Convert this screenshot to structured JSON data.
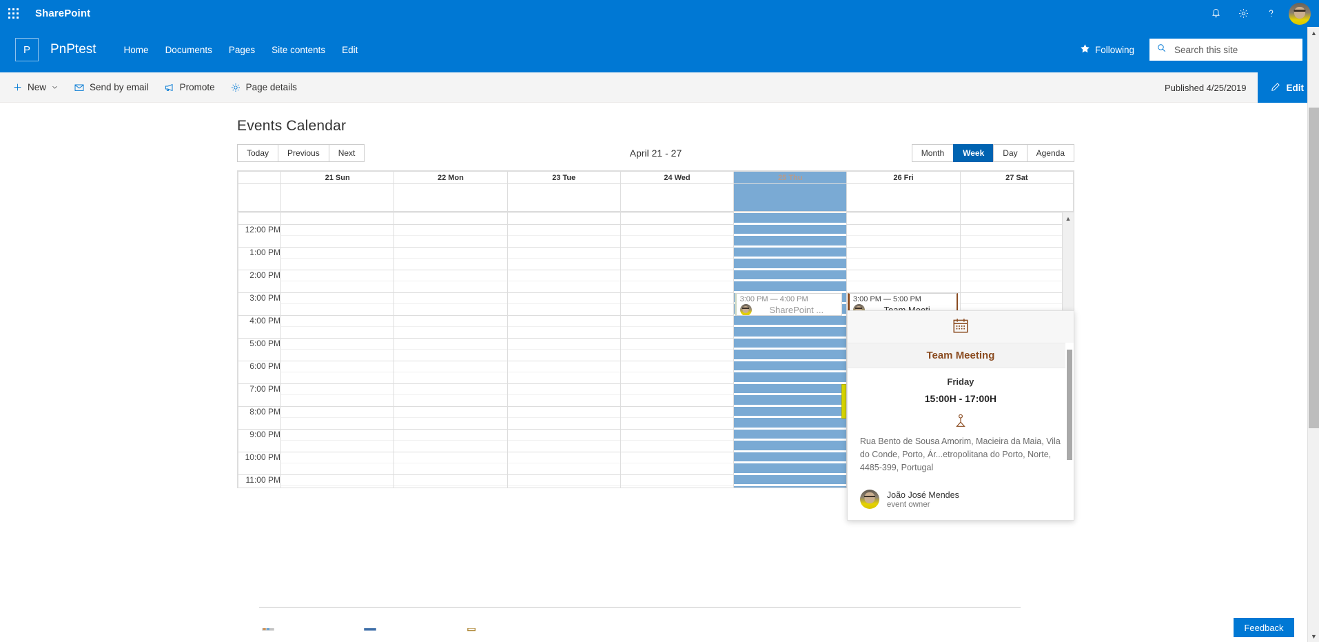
{
  "suite": {
    "brand": "SharePoint",
    "waffle_icon": "app-launcher-icon",
    "icons": [
      {
        "name": "notifications-icon"
      },
      {
        "name": "settings-gear-icon"
      },
      {
        "name": "help-icon"
      }
    ],
    "avatar": "user-avatar"
  },
  "site": {
    "logo_letter": "P",
    "title": "PnPtest",
    "nav": [
      {
        "label": "Home"
      },
      {
        "label": "Documents"
      },
      {
        "label": "Pages"
      },
      {
        "label": "Site contents"
      },
      {
        "label": "Edit"
      }
    ],
    "following_label": "Following",
    "search_placeholder": "Search this site",
    "search_value": ""
  },
  "command_bar": {
    "items": [
      {
        "label": "New",
        "icon": "plus-icon",
        "has_chevron": true
      },
      {
        "label": "Send by email",
        "icon": "mail-icon",
        "has_chevron": false
      },
      {
        "label": "Promote",
        "icon": "megaphone-icon",
        "has_chevron": false
      },
      {
        "label": "Page details",
        "icon": "gear-icon",
        "has_chevron": false
      }
    ],
    "published_status": "Published 4/25/2019",
    "edit_label": "Edit"
  },
  "webpart": {
    "title": "Events Calendar",
    "nav_buttons": [
      {
        "label": "Today"
      },
      {
        "label": "Previous"
      },
      {
        "label": "Next"
      }
    ],
    "range_label": "April 21 - 27",
    "view_buttons": [
      {
        "label": "Month",
        "active": false
      },
      {
        "label": "Week",
        "active": true
      },
      {
        "label": "Day",
        "active": false
      },
      {
        "label": "Agenda",
        "active": false
      }
    ],
    "days": [
      {
        "label": "21 Sun",
        "today": false
      },
      {
        "label": "22 Mon",
        "today": false
      },
      {
        "label": "23 Tue",
        "today": false
      },
      {
        "label": "24 Wed",
        "today": false
      },
      {
        "label": "25 Thu",
        "today": true
      },
      {
        "label": "26 Fri",
        "today": false
      },
      {
        "label": "27 Sat",
        "today": false
      }
    ],
    "time_labels": [
      "12:00 PM",
      "1:00 PM",
      "2:00 PM",
      "3:00 PM",
      "4:00 PM",
      "5:00 PM",
      "6:00 PM",
      "7:00 PM",
      "8:00 PM",
      "9:00 PM",
      "10:00 PM",
      "11:00 PM"
    ],
    "events": [
      {
        "id": "sharepoint-event",
        "time": "3:00 PM — 4:00 PM",
        "title": "SharePoint ...",
        "day": "25 Thu",
        "accent": "#cfd9c6"
      },
      {
        "id": "team-meeting-event",
        "time": "3:00 PM — 5:00 PM",
        "title": "Team Meeti...",
        "day": "26 Fri",
        "accent": "#8b4c21"
      }
    ]
  },
  "callout": {
    "header_icon": "calendar-icon",
    "title": "Team Meeting",
    "day": "Friday",
    "time": "15:00H - 17:00H",
    "location_icon": "location-pin-icon",
    "address": "Rua Bento de Sousa Amorim, Macieira da Maia, Vila do Conde, Porto, Ár...etropolitana do Porto, Norte, 4485-399, Portugal",
    "owner_name": "João José Mendes",
    "owner_role": "event owner",
    "accent_color": "#8b4c21"
  },
  "footer": {
    "feedback_label": "Feedback"
  },
  "colors": {
    "brand_blue": "#0078d4",
    "active_blue": "#0063b1",
    "today_blue": "#7aaad4",
    "event_accent": "#8b4c21"
  }
}
